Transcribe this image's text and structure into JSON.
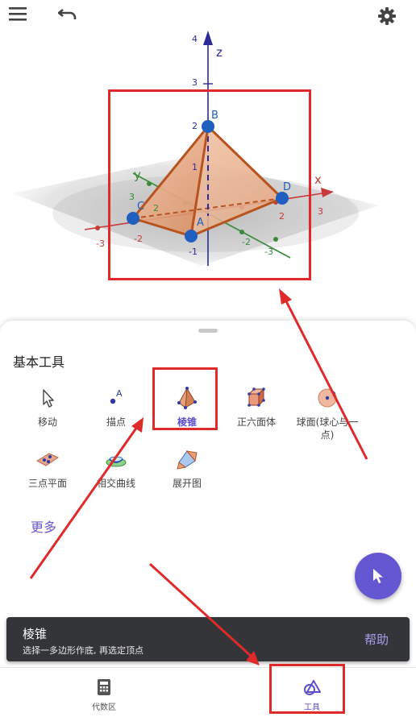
{
  "toolbar": {
    "menu_icon": "menu-icon",
    "undo_icon": "undo-icon",
    "settings_icon": "gear-icon"
  },
  "graphics": {
    "axis_x": "x",
    "axis_y": "y",
    "axis_z": "z",
    "z_ticks": [
      "4",
      "3",
      "2",
      "1",
      "-1"
    ],
    "x_ticks": [
      "-3",
      "-2",
      "2",
      "3"
    ],
    "y_ticks": [
      "3",
      "2",
      "-2",
      "-3"
    ],
    "points": [
      "A",
      "B",
      "C",
      "D"
    ]
  },
  "sheet": {
    "section_title": "基本工具",
    "tools": [
      {
        "label": "移动",
        "icon": "move-cursor-icon"
      },
      {
        "label": "描点",
        "icon": "point-icon"
      },
      {
        "label": "棱锥",
        "icon": "pyramid-icon"
      },
      {
        "label": "正六面体",
        "icon": "cube-icon"
      },
      {
        "label": "球面(球心与一点)",
        "icon": "sphere-icon"
      },
      {
        "label": "三点平面",
        "icon": "plane-three-points-icon"
      },
      {
        "label": "相交曲线",
        "icon": "intersect-curve-icon"
      },
      {
        "label": "展开图",
        "icon": "net-icon"
      }
    ],
    "more_label": "更多",
    "fab_icon": "cursor-icon"
  },
  "snackbar": {
    "title": "棱锥",
    "description": "选择一多边形作底, 再选定顶点",
    "help_label": "帮助"
  },
  "bottom_nav": {
    "items": [
      {
        "label": "代数区",
        "icon": "calculator-icon"
      },
      {
        "label": "工具",
        "icon": "tools-icon"
      }
    ]
  },
  "colors": {
    "accent": "#6557d2",
    "annotation_red": "#e02a2a",
    "pyramid_fill": "#d9895a",
    "pyramid_edge": "#b9531e",
    "point_blue": "#1f5fbf"
  }
}
